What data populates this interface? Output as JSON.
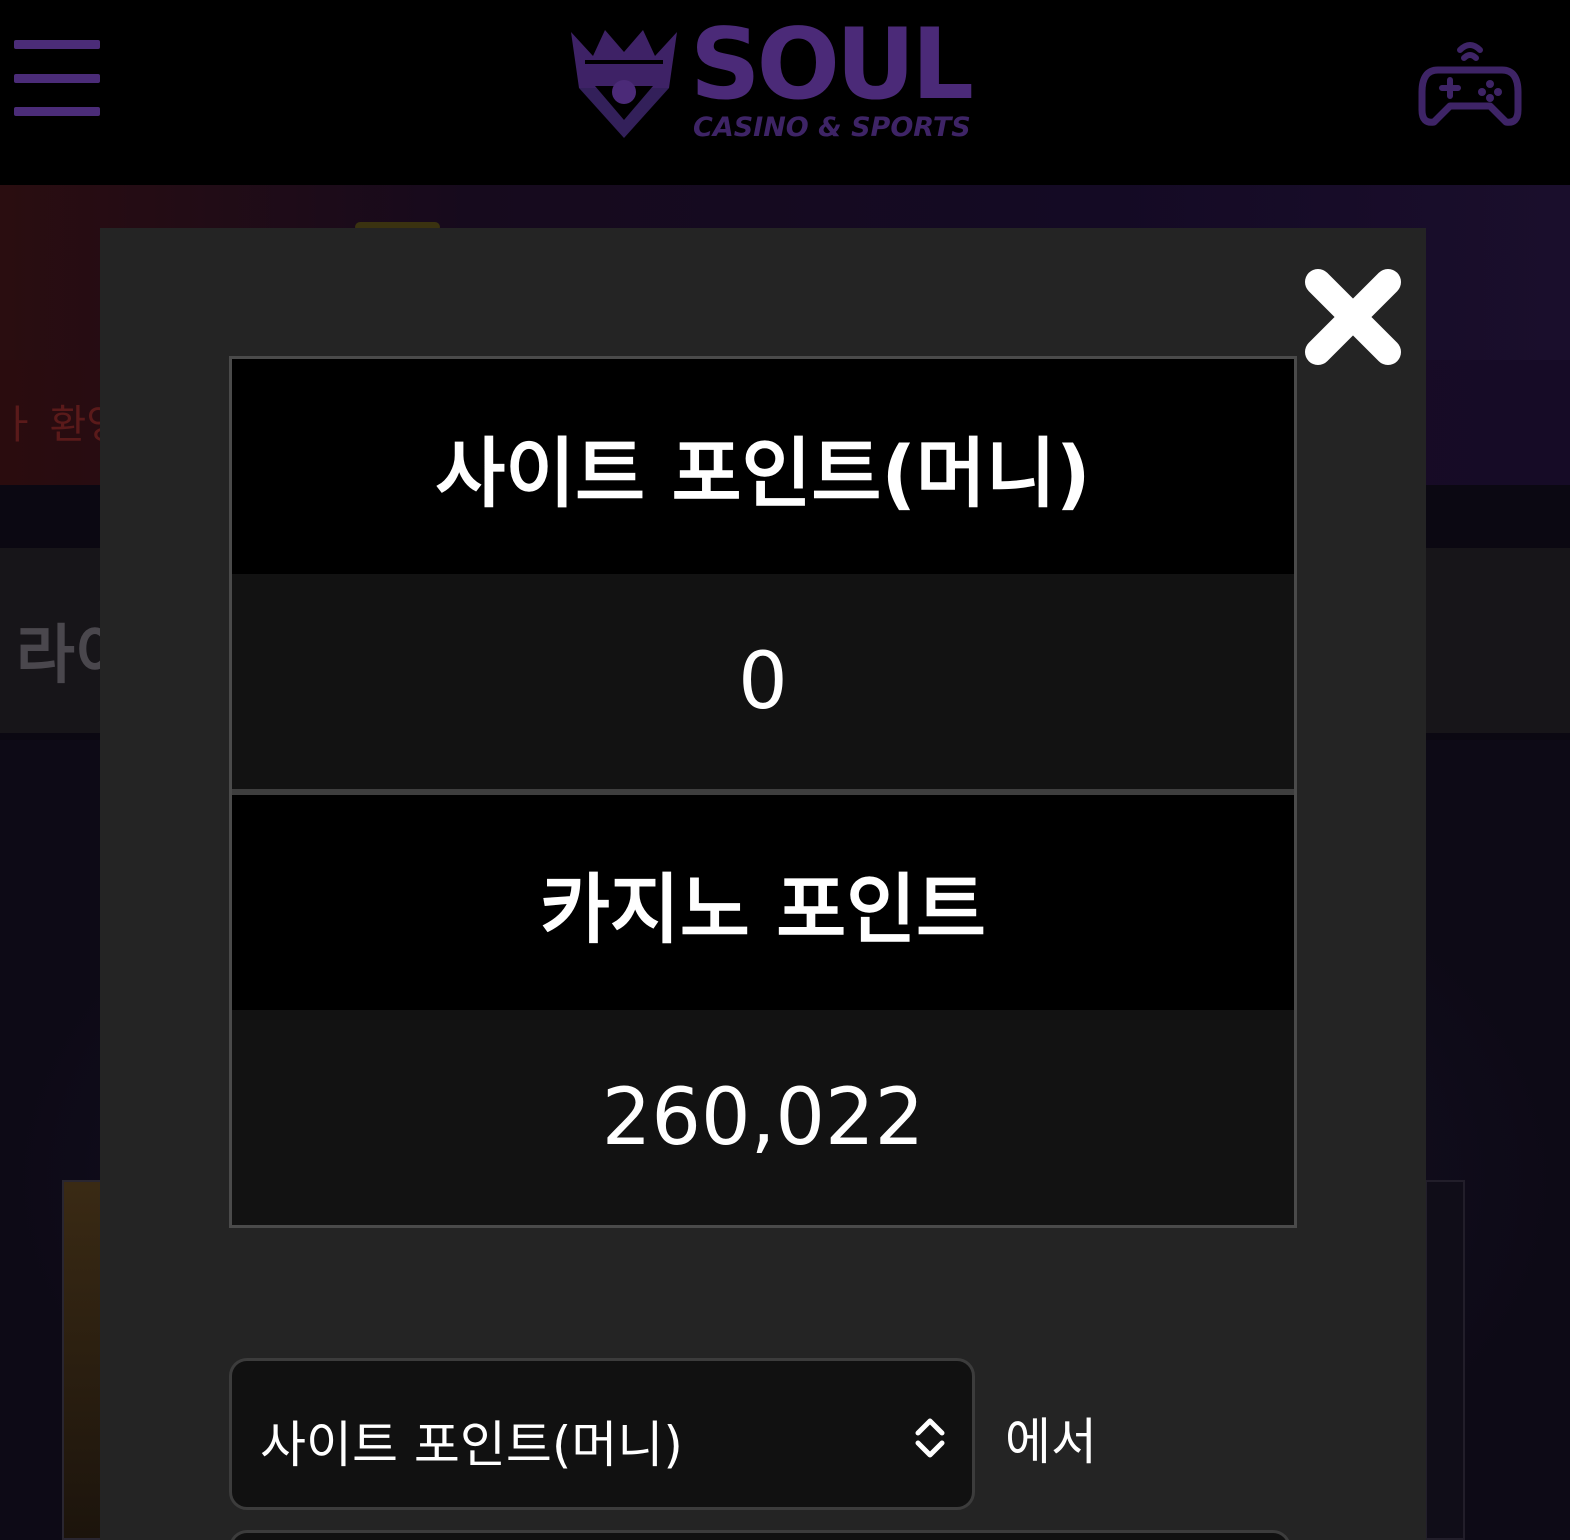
{
  "header": {
    "logo_text": "SOUL",
    "logo_subtext": "CASINO & SPORTS",
    "menu_icon": "hamburger-menu-icon",
    "game_icon": "gamepad-icon"
  },
  "background": {
    "welcome_text_fragment": "ㅏ 환영",
    "section_title_fragment": "라이"
  },
  "modal": {
    "close_icon": "close-icon",
    "site_points_label": "사이트 포인트(머니)",
    "site_points_value": "0",
    "casino_points_label": "카지노 포인트",
    "casino_points_value": "260,022",
    "from_select": {
      "selected": "사이트 포인트(머니)",
      "icon": "select-arrows-icon"
    },
    "from_suffix": "에서"
  },
  "colors": {
    "brand_purple": "#4b2a78",
    "modal_bg": "#242424",
    "table_head_bg": "#000000"
  }
}
